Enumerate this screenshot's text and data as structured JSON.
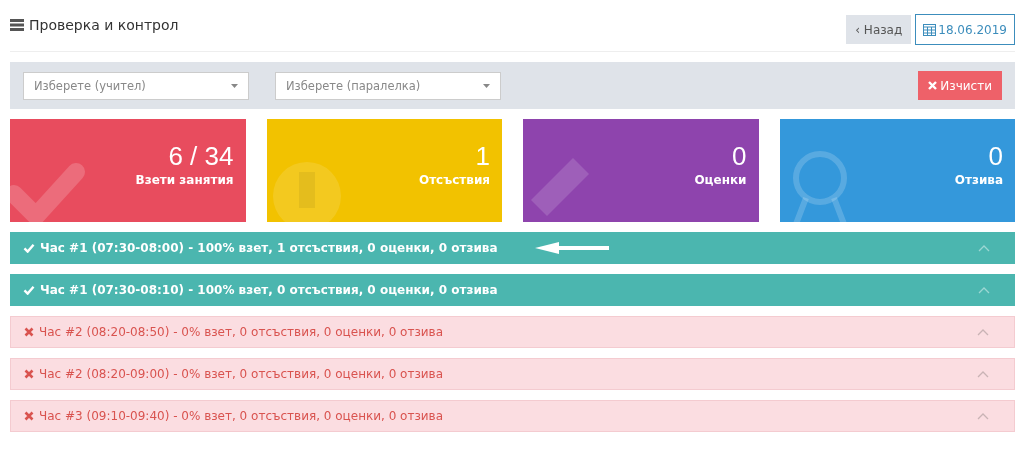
{
  "header": {
    "title": "Проверка и контрол",
    "back_button": "‹ Назад",
    "date_button": "18.06.2019"
  },
  "filters": {
    "teacher": {
      "placeholder": "Изберете (учител)"
    },
    "class": {
      "placeholder": "Изберете (паралелка)"
    },
    "clear_button": "Изчисти"
  },
  "cards": [
    {
      "kind": "taken",
      "value": "6 / 34",
      "label": "Взети занятия",
      "color": "#e84c5e"
    },
    {
      "kind": "absences",
      "value": "1",
      "label": "Отсъствия",
      "color": "#f2c200"
    },
    {
      "kind": "grades",
      "value": "0",
      "label": "Оценки",
      "color": "#8e44ad"
    },
    {
      "kind": "feedback",
      "value": "0",
      "label": "Отзива",
      "color": "#3498db"
    }
  ],
  "lessons": [
    {
      "kind": "done",
      "text": "Час #1 (07:30-08:00) - 100% взет, 1 отсъствия, 0 оценки, 0 отзива",
      "pointer": true
    },
    {
      "kind": "done",
      "text": "Час #1 (07:30-08:10) - 100% взет, 0 отсъствия, 0 оценки, 0 отзива",
      "pointer": false
    },
    {
      "kind": "missed",
      "text": "Час #2 (08:20-08:50) - 0% взет, 0 отсъствия, 0 оценки, 0 отзива",
      "pointer": false
    },
    {
      "kind": "missed",
      "text": "Час #2 (08:20-09:00) - 0% взет, 0 отсъствия, 0 оценки, 0 отзива",
      "pointer": false
    },
    {
      "kind": "missed",
      "text": "Час #3 (09:10-09:40) - 0% взет, 0 отсъствия, 0 оценки, 0 отзива",
      "pointer": false
    }
  ]
}
